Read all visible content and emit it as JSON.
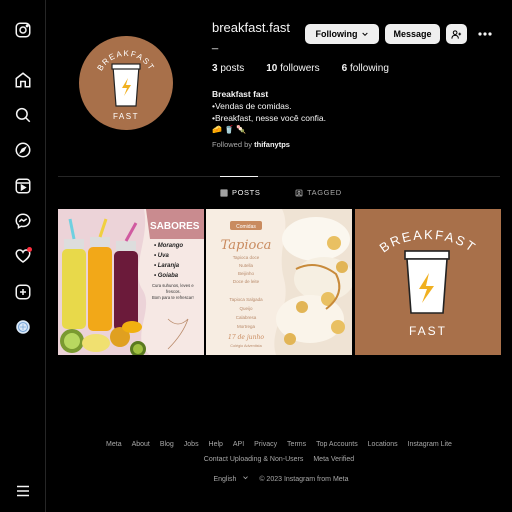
{
  "profile": {
    "username": "breakfast.fast",
    "username_suffix": "_",
    "following_label": "Following",
    "message_label": "Message",
    "posts_count": "3",
    "posts_label": "posts",
    "followers_count": "10",
    "followers_label": "followers",
    "following_count": "6",
    "following_count_label": "following",
    "bio_name": "Breakfast fast",
    "bio_line1": "•Vendas de comidas.",
    "bio_line2": "•Breakfast, nesse você confia.",
    "bio_emojis": "🧀 🥤 🍡",
    "followed_by_prefix": "Followed by",
    "followed_by_user": "thifanytps"
  },
  "avatar": {
    "text_top": "BREAKFAST",
    "text_bottom": "FAST"
  },
  "tabs": [
    {
      "label": "POSTS",
      "active": true
    },
    {
      "label": "TAGGED",
      "active": false
    }
  ],
  "posts": {
    "post1": {
      "heading": "SABORES",
      "flavors": [
        "• Morango",
        "• Uva",
        "• Laranja",
        "• Goiaba"
      ],
      "caption_line1": "Cura suhunos, leves e",
      "caption_line2": "frescos.",
      "caption_line3": "Bom para te refrescar!"
    },
    "post2": {
      "tag": "Comidas",
      "title": "Tapioca",
      "sweet": [
        "Tapioca doce",
        "Nutella",
        "Beijinho",
        "Doce de leite"
      ],
      "savory": [
        "Tapioca Salgada",
        "Queijo",
        "Calabresa",
        "Mortrega"
      ],
      "date": "17 de junho",
      "place": "Colégio Adventista"
    },
    "post3": {
      "text_top": "BREAKFAST",
      "text_bottom": "FAST"
    }
  },
  "footer": {
    "links": [
      "Meta",
      "About",
      "Blog",
      "Jobs",
      "Help",
      "API",
      "Privacy",
      "Terms",
      "Top Accounts",
      "Locations",
      "Instagram Lite"
    ],
    "links2": [
      "Contact Uploading & Non-Users",
      "Meta Verified"
    ],
    "language": "English",
    "copyright": "© 2023 Instagram from Meta"
  },
  "colors": {
    "brand_brown": "#a8704a",
    "cream": "#f6ebe0",
    "notification_red": "#ff3040"
  },
  "icons": [
    "instagram-icon",
    "home-icon",
    "search-icon",
    "explore-icon",
    "reels-icon",
    "messenger-icon",
    "heart-icon",
    "create-icon",
    "profile-avatar-icon",
    "menu-icon"
  ]
}
